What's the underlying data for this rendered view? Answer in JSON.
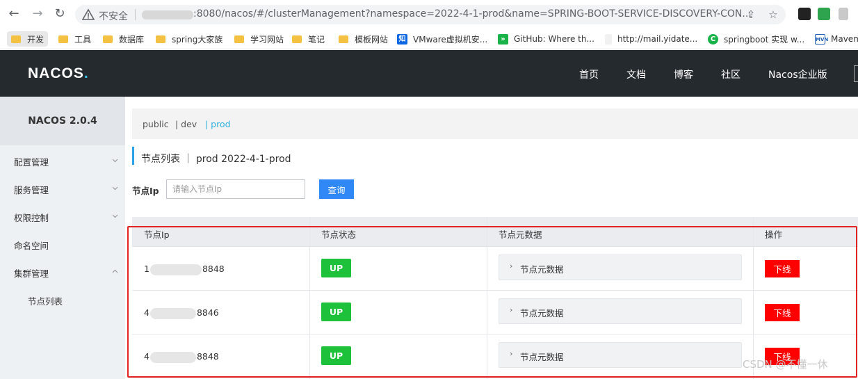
{
  "browser": {
    "insecure_label": "不安全",
    "url_text": ":8080/nacos/#/clusterManagement?namespace=2022-4-1-prod&name=SPRING-BOOT-SERVICE-DISCOVERY-CON...",
    "back_icon": "back-arrow-icon",
    "forward_icon": "forward-arrow-icon",
    "reload_icon": "reload-icon",
    "bookmarks": [
      {
        "label": "开发",
        "icon": "folder-icon"
      },
      {
        "label": "工具",
        "icon": "folder-icon"
      },
      {
        "label": "数据库",
        "icon": "folder-icon"
      },
      {
        "label": "spring大家族",
        "icon": "folder-icon"
      },
      {
        "label": "学习网站",
        "icon": "folder-icon"
      },
      {
        "label": "笔记",
        "icon": "folder-icon"
      },
      {
        "label": "模板网站",
        "icon": "folder-icon"
      },
      {
        "label": "VMware虚拟机安...",
        "icon": "zhihu-icon"
      },
      {
        "label": "GitHub: Where th...",
        "icon": "github-icon"
      },
      {
        "label": "http://mail.yidate...",
        "icon": "page-icon"
      },
      {
        "label": "springboot 实现 w...",
        "icon": "csdn-icon"
      },
      {
        "label": "Maven",
        "icon": "maven-icon"
      }
    ]
  },
  "header": {
    "logo": "NACOS",
    "logo_dot": ".",
    "nav": [
      "首页",
      "文档",
      "博客",
      "社区",
      "Nacos企业版"
    ]
  },
  "sidebar": {
    "version": "NACOS 2.0.4",
    "items": [
      {
        "label": "配置管理",
        "expanded": false
      },
      {
        "label": "服务管理",
        "expanded": false
      },
      {
        "label": "权限控制",
        "expanded": false
      },
      {
        "label": "命名空间"
      },
      {
        "label": "集群管理",
        "expanded": true
      }
    ],
    "sub_items": [
      {
        "label": "节点列表"
      }
    ]
  },
  "namespaces": [
    {
      "label": "public",
      "active": false
    },
    {
      "label": "| dev",
      "active": false
    },
    {
      "label": "| prod",
      "active": true
    }
  ],
  "page": {
    "title": "节点列表 ｜ prod  2022-4-1-prod",
    "ip_label": "节点Ip",
    "ip_placeholder": "请输入节点Ip",
    "query_label": "查询"
  },
  "table": {
    "headers": [
      "节点Ip",
      "节点状态",
      "节点元数据",
      "操作"
    ],
    "rows": [
      {
        "ip_prefix": "1",
        "ip_suffix": "8848",
        "status": "UP",
        "meta": "节点元数据",
        "action": "下线"
      },
      {
        "ip_prefix": "4",
        "ip_suffix": "8846",
        "status": "UP",
        "meta": "节点元数据",
        "action": "下线"
      },
      {
        "ip_prefix": "4",
        "ip_suffix": "8848",
        "status": "UP",
        "meta": "节点元数据",
        "action": "下线"
      }
    ]
  },
  "watermark": "CSDN @不懂一休",
  "colors": {
    "header_bg": "#252a2f",
    "accent_blue": "#2f88f5",
    "status_up": "#1ec13a",
    "offline_red": "#ff0000",
    "highlight_red": "#e32222"
  }
}
